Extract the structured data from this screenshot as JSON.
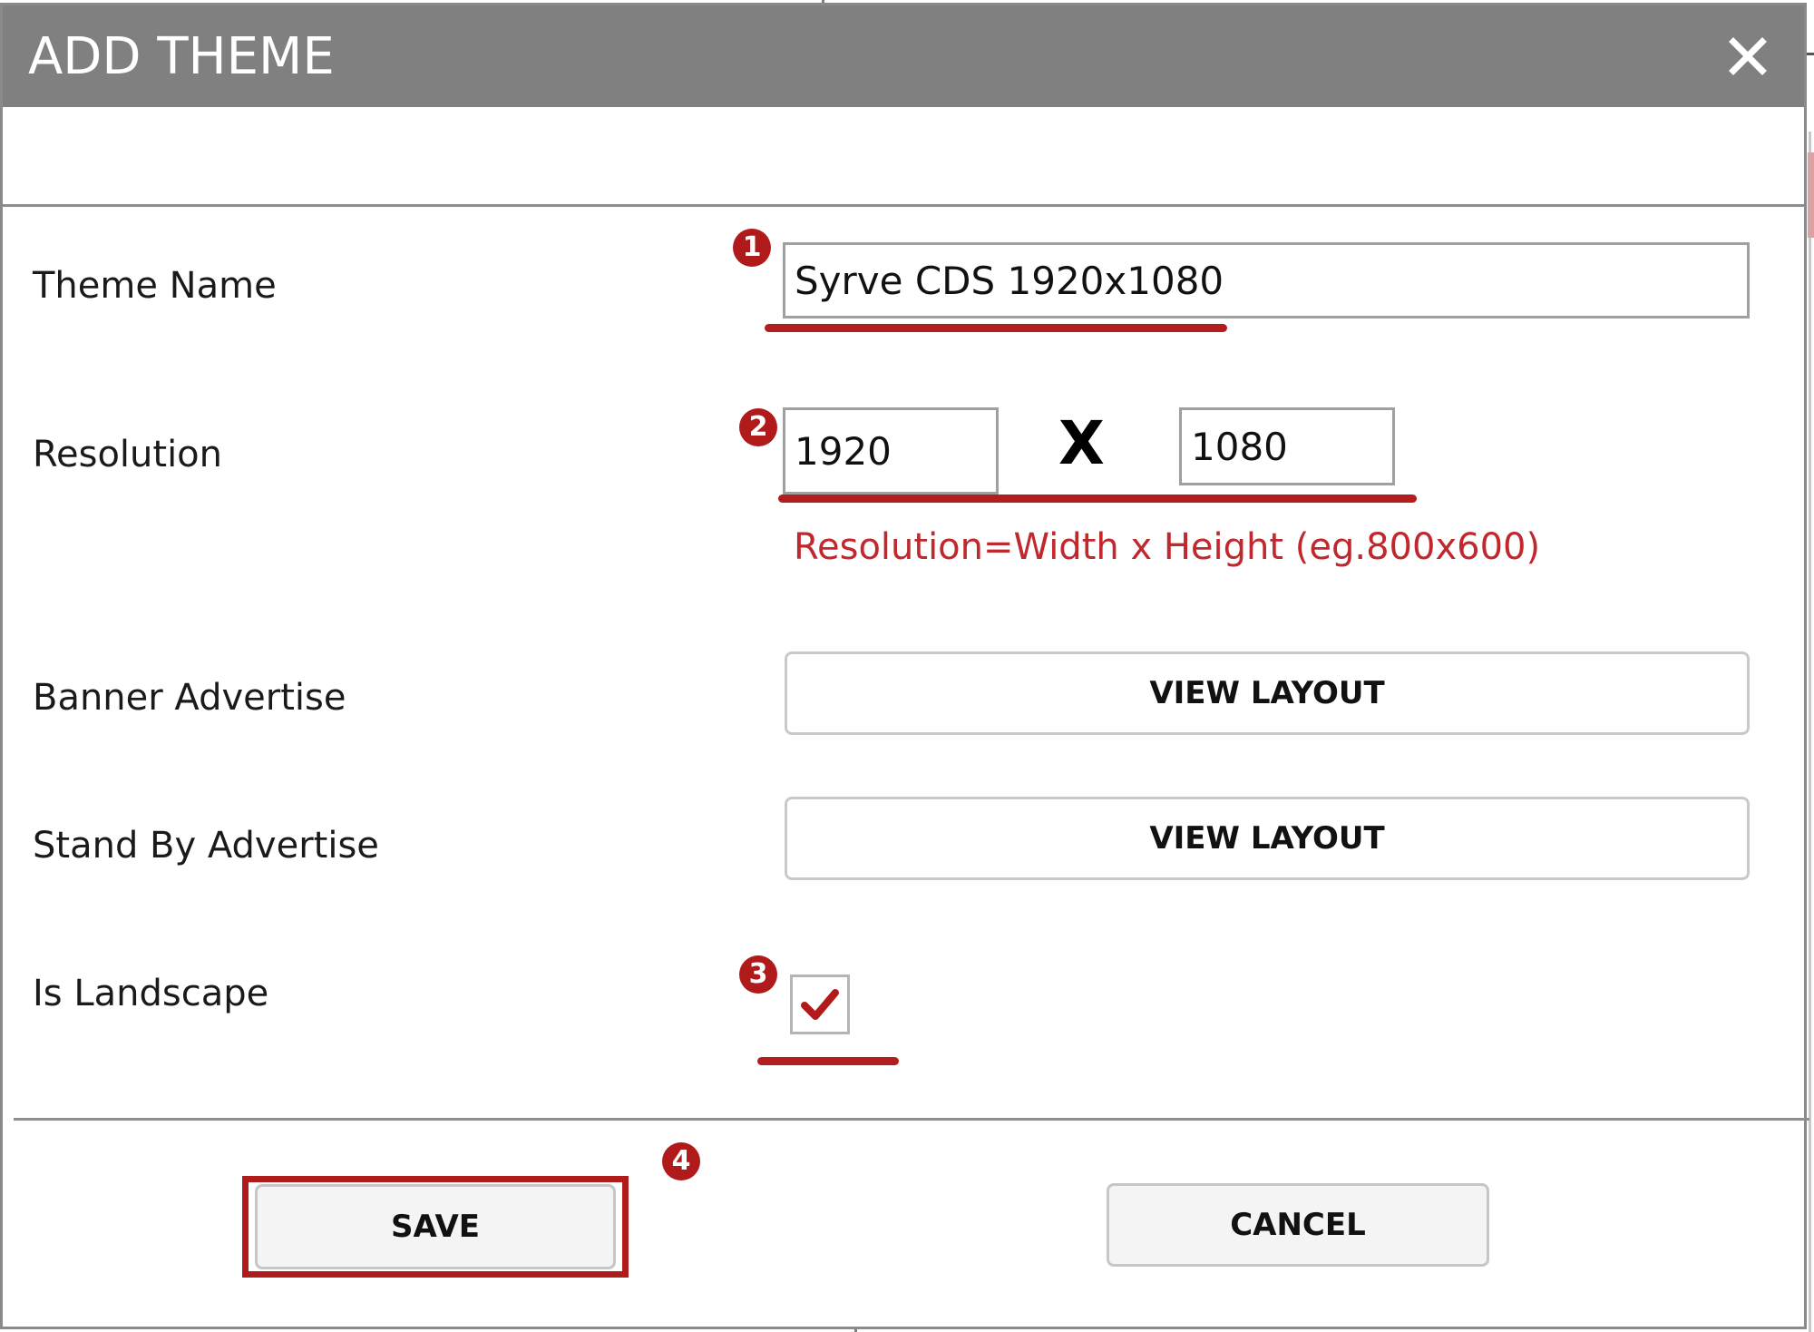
{
  "dialog": {
    "title": "ADD THEME"
  },
  "form": {
    "theme_name": {
      "label": "Theme Name",
      "value": "Syrve CDS 1920x1080",
      "step": "1"
    },
    "resolution": {
      "label": "Resolution",
      "width": "1920",
      "height": "1080",
      "separator": "X",
      "hint": "Resolution=Width x Height (eg.800x600)",
      "step": "2"
    },
    "banner": {
      "label": "Banner Advertise",
      "button_label": "VIEW LAYOUT"
    },
    "standby": {
      "label": "Stand By Advertise",
      "button_label": "VIEW LAYOUT"
    },
    "landscape": {
      "label": "Is Landscape",
      "checked": true,
      "step": "3"
    }
  },
  "footer": {
    "save_label": "SAVE",
    "cancel_label": "CANCEL",
    "save_step": "4"
  },
  "colors": {
    "titlebar": "#808080",
    "accent_red": "#b11a1a",
    "hint_red": "#c0282d"
  }
}
